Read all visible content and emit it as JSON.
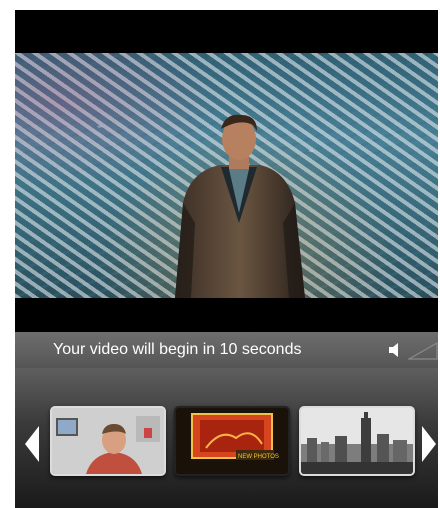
{
  "player": {
    "status_text": "Your video will begin in 10 seconds"
  },
  "controls": {
    "speaker_icon": "speaker-icon",
    "volume_icon": "volume-level-icon"
  },
  "carousel": {
    "prev_icon": "arrow-left-icon",
    "next_icon": "arrow-right-icon",
    "thumbnails": [
      {
        "name": "thumbnail-man-in-office"
      },
      {
        "name": "thumbnail-new-photos",
        "badge": "NEW PHOTOS"
      },
      {
        "name": "thumbnail-city-skyline"
      }
    ]
  },
  "colors": {
    "status_bar": "#5f5f5f",
    "arrow": "#ffffff",
    "text": "#ffffff"
  }
}
